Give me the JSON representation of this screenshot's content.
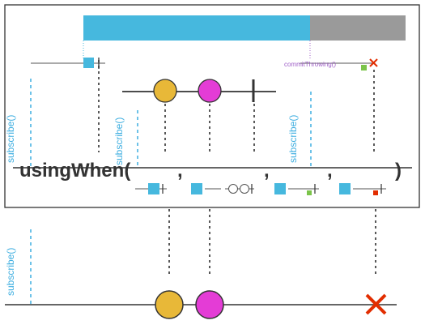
{
  "diagram": {
    "operator_label": "usingWhen(",
    "operator_comma": ",",
    "operator_close": ")",
    "subscribe_label": "subscribe()",
    "commit_label": "commitThrowing()",
    "colors": {
      "resource_bar": "#46b8de",
      "resource_done": "#9a9a9a",
      "element_yellow": "#e8b838",
      "element_magenta": "#e43cd6",
      "error_red": "#e22d00",
      "square_blue": "#46b8de",
      "square_green": "#7bc44a",
      "dashed_blue": "#3daee0"
    },
    "icons": [
      "error-x-icon",
      "resource-square-icon",
      "element-circle-icon",
      "completion-bar-icon"
    ]
  }
}
